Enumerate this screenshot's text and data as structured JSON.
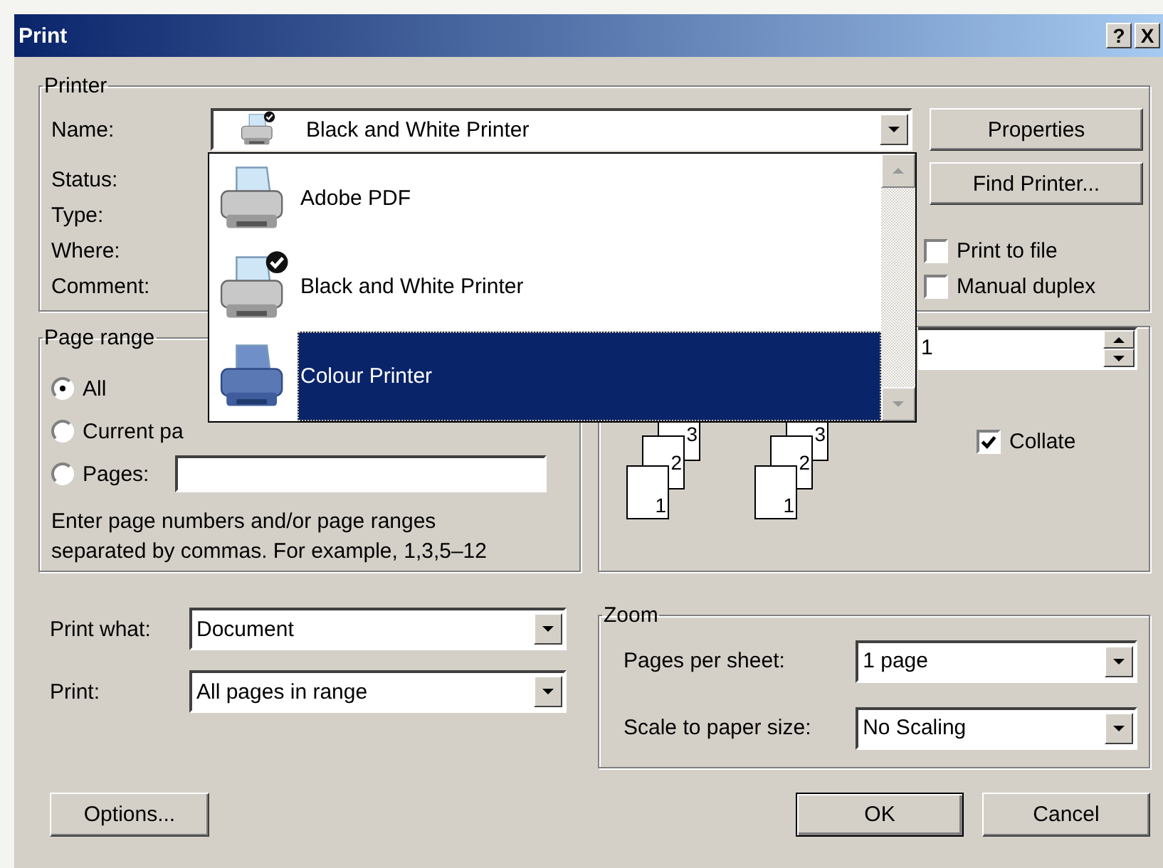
{
  "window": {
    "title": "Print",
    "help_button": "?",
    "close_button": "X"
  },
  "printer": {
    "legend": "Printer",
    "name_label": {
      "text": "Name:"
    },
    "selected_printer": "Black and White Printer",
    "info_labels": [
      "Status:",
      "Type:",
      "Where:",
      "Comment:"
    ],
    "buttons": [
      {
        "label": "Properties"
      },
      {
        "label": "Find Printer..."
      }
    ],
    "options": [
      {
        "label": "Print to file",
        "checked": false
      },
      {
        "label": "Manual duplex",
        "checked": false
      }
    ]
  },
  "printer_list": [
    {
      "name": "Adobe PDF",
      "kind": "mono",
      "default": false,
      "selected": false
    },
    {
      "name": "Black and White Printer",
      "kind": "mono",
      "default": true,
      "selected": false
    },
    {
      "name": "Colour Printer",
      "kind": "colour",
      "default": false,
      "selected": true
    }
  ],
  "page_range": {
    "legend": "Page range",
    "radios": [
      {
        "label": "All",
        "selected": true
      },
      {
        "label": "Current pa",
        "selected": false
      },
      {
        "label": "Pages:",
        "selected": false
      }
    ],
    "help": "Enter page numbers and/or page ranges\nseparated by commas.  For example, 1,3,5–12"
  },
  "copies": {
    "value": "1",
    "stacks": [
      [
        "3",
        "2",
        "1"
      ],
      [
        "3",
        "2",
        "1"
      ]
    ],
    "collate": {
      "label": "Collate",
      "checked": true
    }
  },
  "print_settings": [
    {
      "label": "Print what:",
      "value": "Document"
    },
    {
      "label": "Print:",
      "value": "All pages in range"
    }
  ],
  "zoom": {
    "legend": "Zoom",
    "rows": [
      {
        "label": "Pages per sheet:",
        "value": "1 page"
      },
      {
        "label": "Scale to paper size:",
        "value": "No Scaling"
      }
    ]
  },
  "footer_buttons": [
    {
      "label": "Options...",
      "default": false
    },
    {
      "label": "OK",
      "default": true
    },
    {
      "label": "Cancel",
      "default": false
    }
  ]
}
